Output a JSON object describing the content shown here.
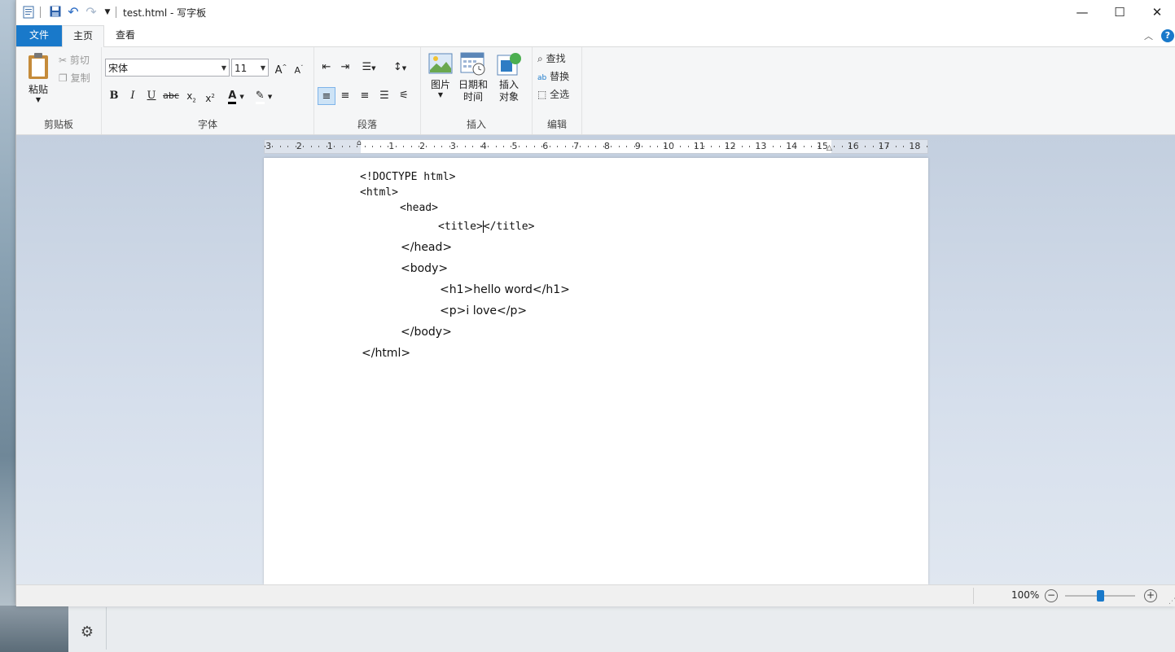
{
  "window": {
    "title": "test.html - 写字板"
  },
  "tabs": {
    "file": "文件",
    "home": "主页",
    "view": "查看"
  },
  "clipboard": {
    "paste": "粘贴",
    "cut": "剪切",
    "copy": "复制",
    "label": "剪贴板"
  },
  "font": {
    "name": "宋体",
    "size": "11",
    "label": "字体"
  },
  "paragraph": {
    "label": "段落"
  },
  "insert": {
    "picture": "图片",
    "datetime_1": "日期和",
    "datetime_2": "时间",
    "object_1": "插入",
    "object_2": "对象",
    "label": "插入"
  },
  "editing": {
    "find": "查找",
    "replace": "替换",
    "select_all": "全选",
    "label": "编辑"
  },
  "ruler": {
    "numbers": [
      "3",
      "2",
      "1",
      "1",
      "2",
      "3",
      "4",
      "5",
      "6",
      "7",
      "8",
      "9",
      "10",
      "11",
      "12",
      "13",
      "14",
      "15",
      "16",
      "17",
      "18"
    ]
  },
  "document": {
    "lines": [
      "<!DOCTYPE html>",
      "<html>",
      "<head>",
      "<title>",
      "</title>",
      "</head>",
      "<body>",
      "<h1>hello word</h1>",
      "<p>i love</p>",
      "</body>",
      "</html>"
    ]
  },
  "status": {
    "zoom": "100%",
    "zoom_level": 0.5
  },
  "colors": {
    "accent": "#1979ca",
    "font_color": "#000000"
  }
}
